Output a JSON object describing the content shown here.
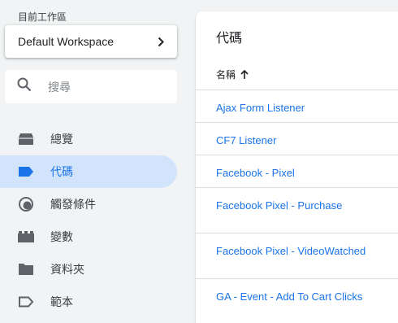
{
  "workspace": {
    "caption": "目前工作區",
    "name": "Default Workspace"
  },
  "search": {
    "placeholder": "搜尋"
  },
  "nav": {
    "items": [
      {
        "label": "總覽",
        "icon": "overview-icon"
      },
      {
        "label": "代碼",
        "icon": "tag-icon",
        "active": true
      },
      {
        "label": "觸發條件",
        "icon": "trigger-icon"
      },
      {
        "label": "變數",
        "icon": "variable-icon"
      },
      {
        "label": "資料夾",
        "icon": "folder-icon"
      },
      {
        "label": "範本",
        "icon": "template-icon"
      }
    ]
  },
  "panel": {
    "title": "代碼",
    "column_header": "名稱",
    "tags": [
      "Ajax Form Listener",
      "CF7 Listener",
      "Facebook - Pixel",
      "Facebook Pixel - Purchase",
      "Facebook Pixel - VideoWatched",
      "GA - Event - Add To Cart Clicks"
    ]
  },
  "colors": {
    "accent": "#1a73e8",
    "active_bg": "#d2e3fc",
    "page_bg": "#f1f3f4"
  }
}
